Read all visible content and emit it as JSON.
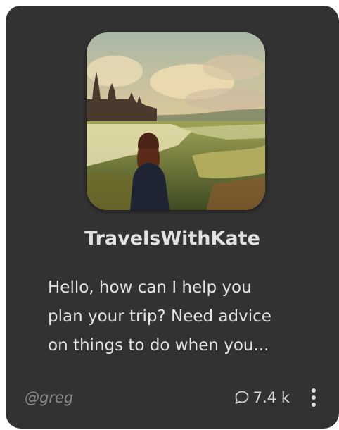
{
  "bot": {
    "name": "TravelsWithKate",
    "description_lines": [
      "Hello, how can I help you",
      "plan your trip? Need advice",
      "on things to do when you..."
    ]
  },
  "footer": {
    "author": "@greg",
    "chat_count": "7.4 k",
    "chat_icon": "chat-bubble-icon",
    "more_icon": "more-vertical-icon"
  },
  "colors": {
    "card_background": "#323232",
    "title_text": "#e2e2e2",
    "author_text": "#8b8b8b"
  }
}
